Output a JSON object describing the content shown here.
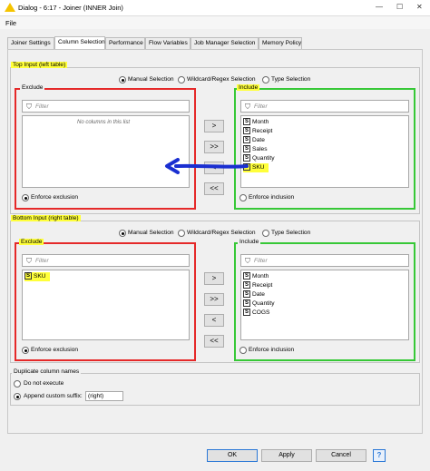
{
  "window": {
    "title": "Dialog - 6:17 - Joiner (INNER Join)",
    "minimize": "—",
    "maximize": "☐",
    "close": "✕"
  },
  "menu": {
    "file": "File"
  },
  "tabs": [
    {
      "label": "Joiner Settings"
    },
    {
      "label": "Column Selection"
    },
    {
      "label": "Performance"
    },
    {
      "label": "Flow Variables"
    },
    {
      "label": "Job Manager Selection"
    },
    {
      "label": "Memory Policy"
    }
  ],
  "top": {
    "group_label": "Top Input (left table)",
    "mode_options": [
      "Manual Selection",
      "Wildcard/Regex Selection",
      "Type Selection"
    ],
    "exclude_label": "Exclude",
    "include_label": "Include",
    "filter_placeholder": "Filter",
    "exclude_empty": "No columns in this list",
    "include_items": [
      "Month",
      "Receipt",
      "Date",
      "Sales",
      "Quantity",
      "SKU"
    ],
    "type_badge": "S",
    "enforce_exclusion": "Enforce exclusion",
    "enforce_inclusion": "Enforce inclusion"
  },
  "bottom": {
    "group_label": "Bottom Input (right table)",
    "mode_options": [
      "Manual Selection",
      "Wildcard/Regex Selection",
      "Type Selection"
    ],
    "exclude_label": "Exclude",
    "include_label": "Include",
    "filter_placeholder": "Filter",
    "exclude_items": [
      "SKU"
    ],
    "include_items": [
      "Month",
      "Receipt",
      "Date",
      "Quantity",
      "COGS"
    ],
    "type_badge": "S",
    "enforce_exclusion": "Enforce exclusion",
    "enforce_inclusion": "Enforce inclusion"
  },
  "move_buttons": {
    "add": ">",
    "add_all": ">>",
    "remove": "<",
    "remove_all": "<<"
  },
  "duplicate": {
    "label": "Duplicate column names",
    "do_not_execute": "Do not execute",
    "append_suffix": "Append custom suffix:",
    "suffix_value": "(right)"
  },
  "footer": {
    "ok": "OK",
    "apply": "Apply",
    "cancel": "Cancel",
    "help": "?"
  },
  "colors": {
    "highlight": "#ffff3a",
    "exclude_border": "#e52929",
    "include_border": "#37c837",
    "arrow": "#1a2fd1"
  },
  "icons": {
    "filter": "funnel-icon",
    "help": "help-icon",
    "arrow": "arrow-left-annotation-icon"
  }
}
